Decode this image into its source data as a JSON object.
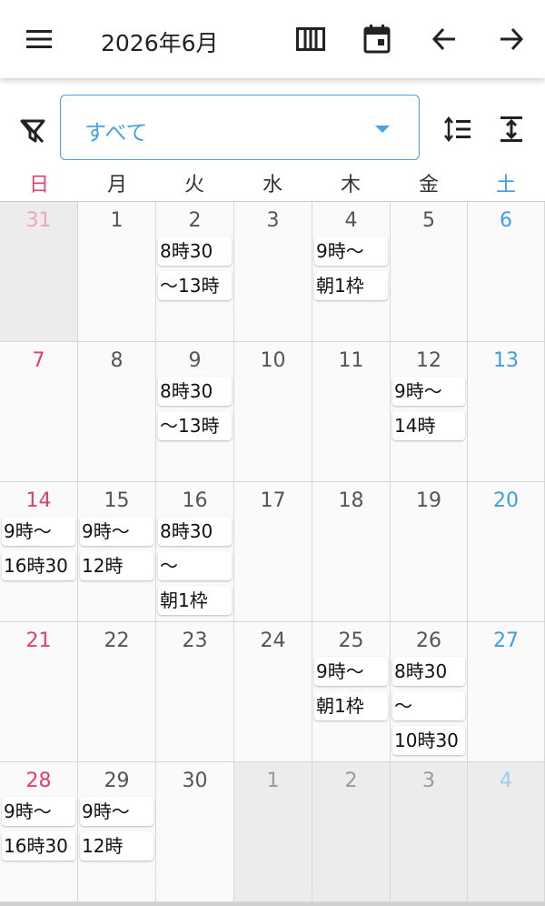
{
  "header": {
    "title": "2026年6月",
    "icons": [
      "menu-icon",
      "week-view-icon",
      "today-icon",
      "arrow-back-icon",
      "arrow-forward-icon"
    ]
  },
  "filter": {
    "selected": "すべて",
    "icons": [
      "filter-off-icon",
      "sort-icon",
      "expand-icon"
    ]
  },
  "weekdays": [
    "日",
    "月",
    "火",
    "水",
    "木",
    "金",
    "土"
  ],
  "colors": {
    "sunday": "#e0406b",
    "saturday": "#3e9ee0",
    "accent": "#4aa3df"
  },
  "weeks": [
    [
      {
        "day": "31",
        "other": true,
        "events": []
      },
      {
        "day": "1",
        "events": []
      },
      {
        "day": "2",
        "events": [
          "8時30",
          "〜13時"
        ]
      },
      {
        "day": "3",
        "events": []
      },
      {
        "day": "4",
        "events": [
          "9時〜",
          "朝1枠"
        ]
      },
      {
        "day": "5",
        "events": []
      },
      {
        "day": "6",
        "events": []
      }
    ],
    [
      {
        "day": "7",
        "events": []
      },
      {
        "day": "8",
        "events": []
      },
      {
        "day": "9",
        "events": [
          "8時30",
          "〜13時"
        ]
      },
      {
        "day": "10",
        "events": []
      },
      {
        "day": "11",
        "events": []
      },
      {
        "day": "12",
        "events": [
          "9時〜",
          "14時"
        ]
      },
      {
        "day": "13",
        "events": []
      }
    ],
    [
      {
        "day": "14",
        "events": [
          "9時〜",
          "16時30"
        ]
      },
      {
        "day": "15",
        "events": [
          "9時〜",
          "12時"
        ]
      },
      {
        "day": "16",
        "events": [
          "8時30",
          "〜",
          "朝1枠"
        ]
      },
      {
        "day": "17",
        "events": []
      },
      {
        "day": "18",
        "events": []
      },
      {
        "day": "19",
        "events": []
      },
      {
        "day": "20",
        "events": []
      }
    ],
    [
      {
        "day": "21",
        "events": []
      },
      {
        "day": "22",
        "events": []
      },
      {
        "day": "23",
        "events": []
      },
      {
        "day": "24",
        "events": []
      },
      {
        "day": "25",
        "events": [
          "9時〜",
          "朝1枠"
        ]
      },
      {
        "day": "26",
        "events": [
          "8時30",
          "〜",
          "10時30"
        ]
      },
      {
        "day": "27",
        "events": []
      }
    ],
    [
      {
        "day": "28",
        "events": [
          "9時〜",
          "16時30"
        ]
      },
      {
        "day": "29",
        "events": [
          "9時〜",
          "12時"
        ]
      },
      {
        "day": "30",
        "events": []
      },
      {
        "day": "1",
        "other": true,
        "events": []
      },
      {
        "day": "2",
        "other": true,
        "events": []
      },
      {
        "day": "3",
        "other": true,
        "events": []
      },
      {
        "day": "4",
        "other": true,
        "events": []
      }
    ]
  ]
}
